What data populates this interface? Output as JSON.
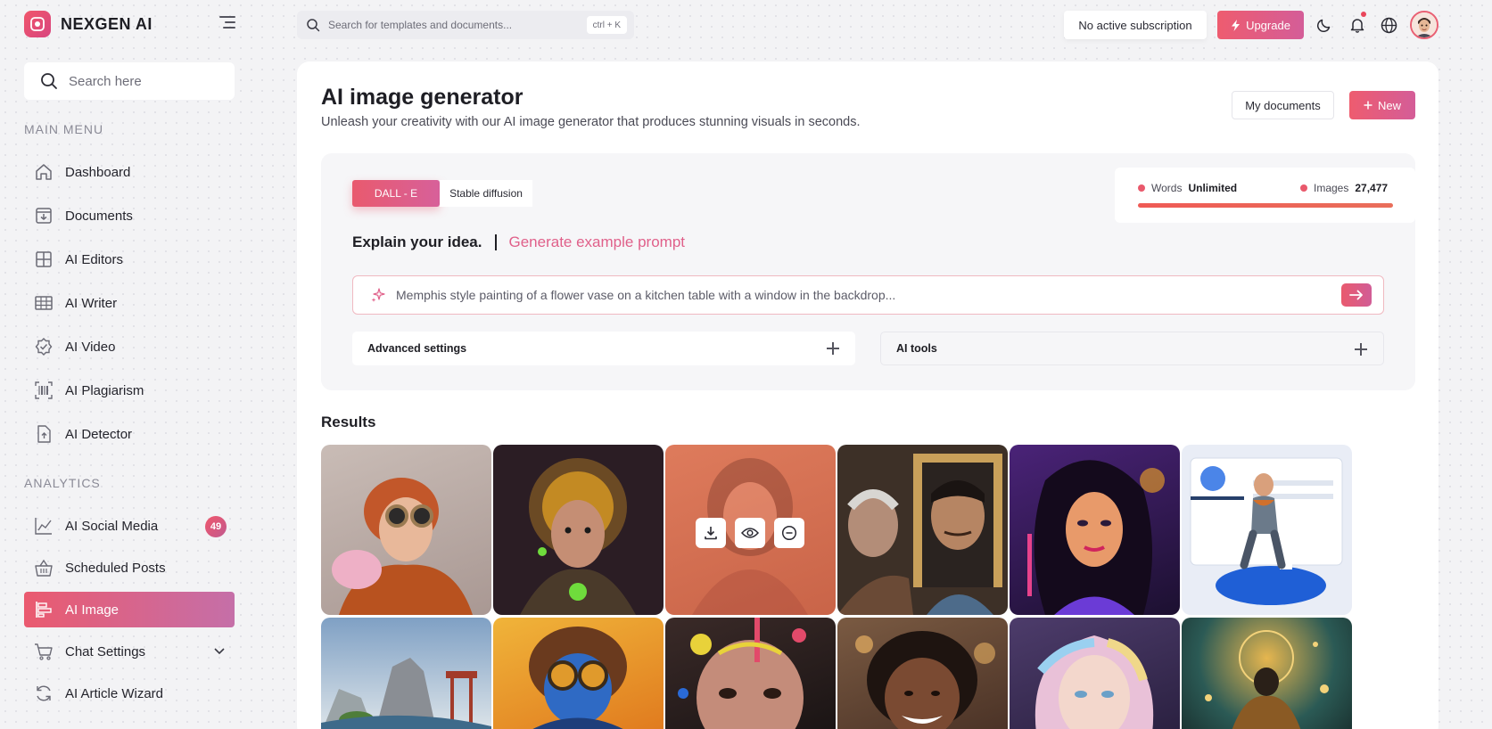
{
  "app": {
    "name": "NEXGEN AI"
  },
  "sidebar": {
    "search_placeholder": "Search here",
    "main_menu_label": "MAIN MENU",
    "analytics_label": "ANALYTICS",
    "main_items": [
      {
        "label": "Dashboard",
        "icon": "home-icon"
      },
      {
        "label": "Documents",
        "icon": "document-download-icon"
      },
      {
        "label": "AI Editors",
        "icon": "grid-icon"
      },
      {
        "label": "AI Writer",
        "icon": "table-icon"
      },
      {
        "label": "AI Video",
        "icon": "badge-check-icon"
      },
      {
        "label": "AI Plagiarism",
        "icon": "barcode-scan-icon"
      },
      {
        "label": "AI Detector",
        "icon": "file-upload-icon"
      }
    ],
    "analytics_items": [
      {
        "label": "AI Social Media",
        "icon": "trend-chart-icon",
        "badge": "49"
      },
      {
        "label": "Scheduled Posts",
        "icon": "basket-icon"
      },
      {
        "label": "AI Image",
        "icon": "align-chart-icon",
        "active": true
      },
      {
        "label": "Chat Settings",
        "icon": "cart-icon",
        "expandable": true
      },
      {
        "label": "AI Article Wizard",
        "icon": "refresh-icon"
      }
    ]
  },
  "topbar": {
    "search_placeholder": "Search for templates and documents...",
    "shortcut": "ctrl + K",
    "subscription_status": "No active subscription",
    "upgrade_label": "Upgrade"
  },
  "page": {
    "title": "AI image generator",
    "subtitle": "Unleash your creativity with our AI image generator that produces stunning visuals in seconds.",
    "my_documents_label": "My documents",
    "new_label": "New"
  },
  "generator": {
    "tabs": [
      {
        "label": "DALL - E",
        "active": true
      },
      {
        "label": "Stable diffusion",
        "active": false
      }
    ],
    "usage": {
      "words_label": "Words",
      "words_value": "Unlimited",
      "images_label": "Images",
      "images_value": "27,477"
    },
    "explain_label": "Explain your idea.",
    "example_prompt_link": "Generate example prompt",
    "prompt_placeholder": "Memphis style painting of a flower vase on a kitchen table with a window in the backdrop...",
    "advanced_settings_label": "Advanced settings",
    "ai_tools_label": "AI tools"
  },
  "results": {
    "title": "Results",
    "hover_actions": [
      "download-icon",
      "eye-icon",
      "minus-circle-icon"
    ],
    "images": [
      {
        "subject": "steampunk-boy",
        "bg": "#b9a9a3",
        "accent": "#c2572a"
      },
      {
        "subject": "cyborg-girl",
        "bg": "#2b1d24",
        "accent": "#e8a523"
      },
      {
        "subject": "woman-portrait-hover",
        "bg": "#d9714f",
        "accent": "#b85a44"
      },
      {
        "subject": "man-mirror",
        "bg": "#4a3a2d",
        "accent": "#c9a05a"
      },
      {
        "subject": "neon-woman",
        "bg": "#3a1c55",
        "accent": "#e7428b"
      },
      {
        "subject": "man-on-facebook-logo",
        "bg": "#e9edf6",
        "accent": "#2b6fe0"
      },
      {
        "subject": "mountain-landscape",
        "bg": "#cfd6dc",
        "accent": "#5d7a52"
      },
      {
        "subject": "goggles-boy",
        "bg": "#e9a22c",
        "accent": "#24529c"
      },
      {
        "subject": "paint-splash-face",
        "bg": "#3a2a28",
        "accent": "#e24a6a"
      },
      {
        "subject": "smiling-girl",
        "bg": "#6a4a3a",
        "accent": "#e8b062"
      },
      {
        "subject": "rainbow-hair-girl",
        "bg": "#4d3c6b",
        "accent": "#e9c1d8"
      },
      {
        "subject": "glowing-figure",
        "bg": "#274a47",
        "accent": "#e6b64f"
      }
    ]
  }
}
